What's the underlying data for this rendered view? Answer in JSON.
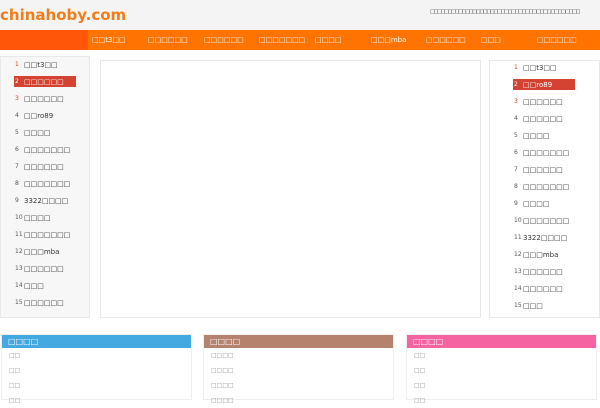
{
  "header": {
    "logo": "chinahoby.com",
    "top_links": "□□□□□□□□□□□□□□□□□□□□□□□□□□□□□□ □□□□ □□□□ □□□□"
  },
  "nav": [
    "□□t3□□",
    "□□□□□□",
    "□□□□□□",
    "□□□□□□□",
    "□□□□",
    "□□□mba",
    "□□□□□□",
    "□□□",
    "□□□□□□"
  ],
  "left_rank": [
    {
      "n": "1",
      "t": "□□t3□□"
    },
    {
      "n": "2",
      "t": "□□□□□□"
    },
    {
      "n": "3",
      "t": "□□□□□□"
    },
    {
      "n": "4",
      "t": "□□ro89"
    },
    {
      "n": "5",
      "t": "□□□□"
    },
    {
      "n": "6",
      "t": "□□□□□□□"
    },
    {
      "n": "7",
      "t": "□□□□□□"
    },
    {
      "n": "8",
      "t": "□□□□□□□"
    },
    {
      "n": "9",
      "t": "3322□□□□"
    },
    {
      "n": "10",
      "t": "□□□□"
    },
    {
      "n": "11",
      "t": "□□□□□□□"
    },
    {
      "n": "12",
      "t": "□□□mba"
    },
    {
      "n": "13",
      "t": "□□□□□□"
    },
    {
      "n": "14",
      "t": "□□□"
    },
    {
      "n": "15",
      "t": "□□□□□□"
    }
  ],
  "right_rank": [
    {
      "n": "1",
      "t": "□□t3□□"
    },
    {
      "n": "2",
      "t": "□□ro89"
    },
    {
      "n": "3",
      "t": "□□□□□□"
    },
    {
      "n": "4",
      "t": "□□□□□□"
    },
    {
      "n": "5",
      "t": "□□□□"
    },
    {
      "n": "6",
      "t": "□□□□□□□"
    },
    {
      "n": "7",
      "t": "□□□□□□"
    },
    {
      "n": "8",
      "t": "□□□□□□□"
    },
    {
      "n": "9",
      "t": "□□□□"
    },
    {
      "n": "10",
      "t": "□□□□□□□"
    },
    {
      "n": "11",
      "t": "3322□□□□"
    },
    {
      "n": "12",
      "t": "□□□mba"
    },
    {
      "n": "13",
      "t": "□□□□□□"
    },
    {
      "n": "14",
      "t": "□□□□□□"
    },
    {
      "n": "15",
      "t": "□□□"
    }
  ],
  "boxes": [
    {
      "title": "□□□□",
      "color": "#45a9e1",
      "items": [
        "□□",
        "□□",
        "□□",
        "□□"
      ]
    },
    {
      "title": "□□□□",
      "color": "#b5826e",
      "items": [
        "□□□□",
        "□□□□",
        "□□□□",
        "□□□□"
      ]
    },
    {
      "title": "□□□□",
      "color": "#f564a0",
      "items": [
        "□□",
        "□□",
        "□□",
        "□□"
      ]
    }
  ]
}
